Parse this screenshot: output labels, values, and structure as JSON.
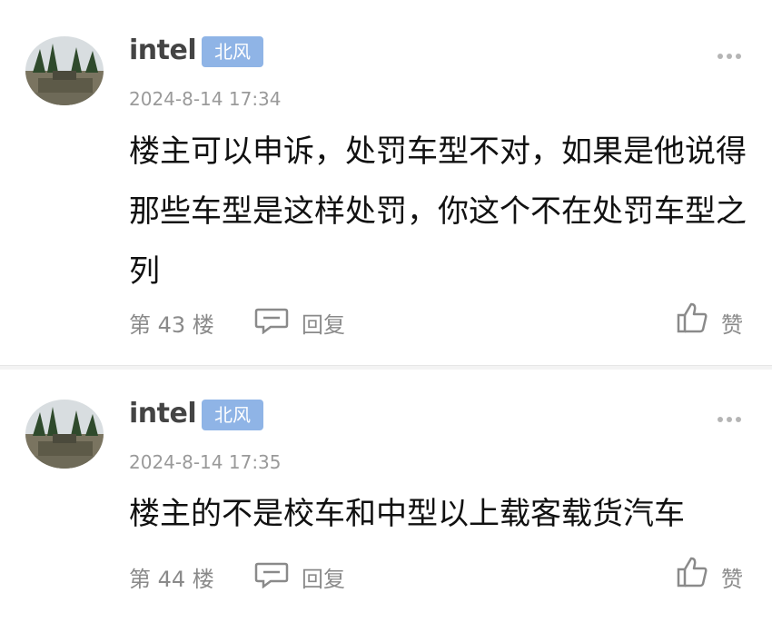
{
  "posts": [
    {
      "username": "intel",
      "badge": "北风",
      "timestamp": "2024-8-14 17:34",
      "content": "楼主可以申诉，处罚车型不对，如果是他说得那些车型是这样处罚，你这个不在处罚车型之列",
      "floor": "第 43 楼",
      "reply_label": "回复",
      "like_label": "赞"
    },
    {
      "username": "intel",
      "badge": "北风",
      "timestamp": "2024-8-14 17:35",
      "content": "楼主的不是校车和中型以上载客载货汽车",
      "floor": "第 44 楼",
      "reply_label": "回复",
      "like_label": "赞"
    }
  ],
  "colors": {
    "badge_bg": "#8fb4e6",
    "muted_text": "#9a9a9a",
    "background": "#f3f3f3"
  },
  "icons": [
    "more-dots-icon",
    "comment-icon",
    "thumbs-up-icon"
  ]
}
